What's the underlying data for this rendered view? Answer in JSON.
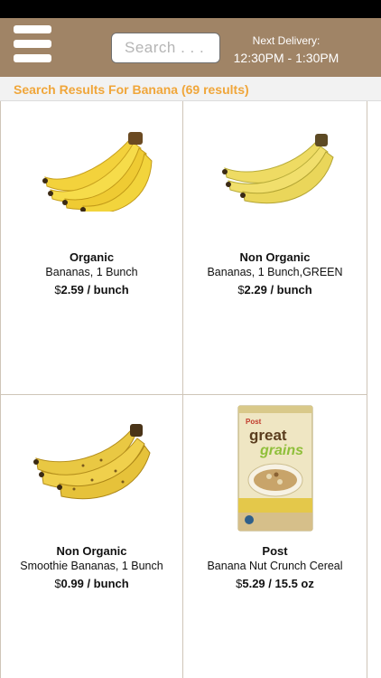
{
  "header": {
    "search_placeholder": "Search . . .",
    "delivery_label": "Next Delivery:",
    "delivery_time": "12:30PM - 1:30PM",
    "background_color": "#a08466"
  },
  "results": {
    "title": "Search Results For Banana (69 results)",
    "accent_color": "#f0a63a"
  },
  "products": [
    {
      "brand": "Organic",
      "name": "Bananas, 1 Bunch",
      "currency": "$",
      "price": "2.59 / bunch",
      "image": "banana-bunch-icon"
    },
    {
      "brand": "Non Organic",
      "name": "Bananas, 1 Bunch,GREEN",
      "currency": "$",
      "price": "2.29 / bunch",
      "image": "banana-bunch-icon"
    },
    {
      "brand": "Non Organic",
      "name": "Smoothie Bananas, 1 Bunch",
      "currency": "$",
      "price": "0.99 / bunch",
      "image": "ripe-banana-bunch-icon"
    },
    {
      "brand": "Post",
      "name": "Banana Nut Crunch Cereal",
      "currency": "$",
      "price": "5.29 / 15.5 oz",
      "image": "cereal-box-icon"
    }
  ]
}
